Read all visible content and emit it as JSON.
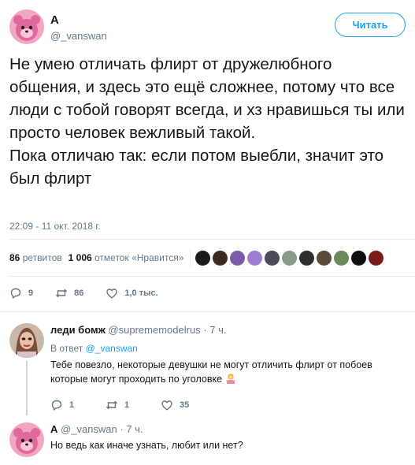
{
  "main_tweet": {
    "author_name": "А",
    "author_handle": "@_vanswan",
    "follow_label": "Читать",
    "text": "Не умею отличать флирт от дружелюбного общения, и здесь это ещё сложнее, потому что все люди с тобой говорят всегда, и хз нравишься ты или просто человек вежливый такой.\nПока отличаю так: если потом выебли, значит это был флирт",
    "timestamp": "22:09 - 11 окт. 2018 г.",
    "retweets_count": "86",
    "retweets_label": "ретвитов",
    "likes_count": "1 006",
    "likes_label": "отметок «Нравится»",
    "actions": {
      "replies": "9",
      "retweets": "86",
      "likes": "1,0 тыс."
    }
  },
  "likers_colors": [
    "#1a1a1a",
    "#3a2a22",
    "#7b5ca8",
    "#9b7ed0",
    "#4a4a58",
    "#8a9a8a",
    "#2e2e2e",
    "#5a4a3a",
    "#6a8a5a",
    "#0f0f0f",
    "#7a1a1a"
  ],
  "replies": [
    {
      "author_name": "леди бомж",
      "author_handle": "@suprememodelrus",
      "time": "· 7 ч.",
      "reply_to_prefix": "В ответ",
      "reply_to_handle": "@_vanswan",
      "text": "Тебе повезло, некоторые девушки не могут отличить флирт от побоев которые могут проходить по уголовке",
      "actions": {
        "replies": "1",
        "retweets": "1",
        "likes": "35"
      }
    },
    {
      "author_name": "А",
      "author_handle": "@_vanswan",
      "time": "· 7 ч.",
      "text": "Но ведь как иначе узнать, любит или нет?"
    }
  ],
  "colors": {
    "accent": "#1da1f2",
    "muted": "#657786",
    "text": "#14171a",
    "avatar_pink": "#e8709a"
  }
}
